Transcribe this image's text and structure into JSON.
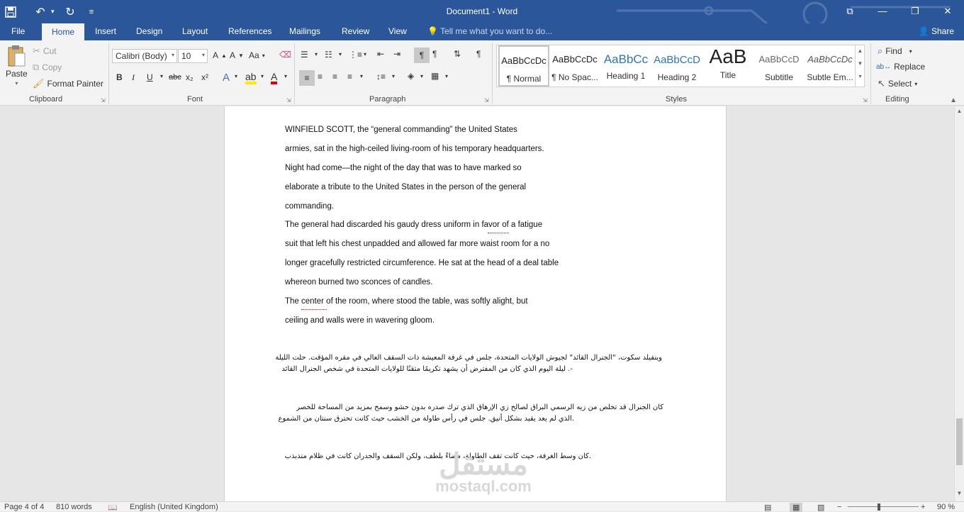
{
  "titlebar": {
    "doc_title": "Document1 - Word",
    "qat": [
      "save-icon",
      "undo-icon",
      "redo-icon",
      "customize-icon"
    ]
  },
  "tabs": {
    "file": "File",
    "home": "Home",
    "insert": "Insert",
    "design": "Design",
    "layout": "Layout",
    "references": "References",
    "mailings": "Mailings",
    "review": "Review",
    "view": "View",
    "tellme": "Tell me what you want to do...",
    "share": "Share"
  },
  "clipboard": {
    "paste": "Paste",
    "cut": "Cut",
    "copy": "Copy",
    "format_painter": "Format Painter",
    "label": "Clipboard"
  },
  "font": {
    "family": "Calibri (Body)",
    "size": "10",
    "change_case": "Aa",
    "label": "Font",
    "bold": "B",
    "italic": "I",
    "underline": "U",
    "strike": "abc",
    "sub": "x₂",
    "sup": "x²"
  },
  "paragraph": {
    "label": "Paragraph"
  },
  "styles": {
    "label": "Styles",
    "items": [
      {
        "preview": "AaBbCcDc",
        "name": "¶ Normal"
      },
      {
        "preview": "AaBbCcDc",
        "name": "¶ No Spac..."
      },
      {
        "preview": "AaBbCc",
        "name": "Heading 1"
      },
      {
        "preview": "AaBbCcD",
        "name": "Heading 2"
      },
      {
        "preview": "AaB",
        "name": "Title"
      },
      {
        "preview": "AaBbCcD",
        "name": "Subtitle"
      },
      {
        "preview": "AaBbCcDc",
        "name": "Subtle Em..."
      }
    ]
  },
  "editing": {
    "label": "Editing",
    "find": "Find",
    "replace": "Replace",
    "select": "Select"
  },
  "document": {
    "lines": [
      "WINFIELD SCOTT, the “general commanding” the United States",
      "armies, sat in the high-ceiled living-room of his temporary headquarters.",
      "Night had come—the night of the day that was to have marked so",
      "elaborate a tribute to the United States in the person of the general",
      "commanding.",
      "The general had discarded his gaudy dress uniform in favor of a fatigue",
      "suit that left his chest unpadded and allowed far more waist room for a no",
      "longer gracefully restricted circumference. He sat at the head of a deal table",
      "whereon burned two sconces of candles.",
      "The center of the room, where stood the table, was softly alight, but",
      "ceiling and walls were in wavering gloom."
    ],
    "arabic": [
      "وينفيلد سكوت، \"الجنرال القائد\" لجيوش الولايات المتحدة، جلس في غرفة المعيشة ذات السقف العالي في مقره المؤقت. حلت الليلة",
      "-. ليلة اليوم الذي كان من المفترض أن يشهد تكريمًا متقنًا للولايات المتحدة في شخص الجنرال القائد",
      "كان الجنرال قد تخلص من زيه الرسمي البراق لصالح زي الإرهاق الذي ترك صدره بدون حشو وسمح بمزيد من المساحة للخصر",
      ".الذي لم يعد يقيد بشكل أنيق. جلس في رأس طاولة من الخشب حيث كانت تحترق سنتان من الشموع",
      ".كان وسط الغرفة، حيث كانت تقف الطاولة، مضاءً بلطف، ولكن السقف والجدران كانت في ظلام متذبذب"
    ],
    "watermark_ar": "مستقل",
    "watermark_en": "mostaql.com"
  },
  "status": {
    "page": "Page 4 of 4",
    "words": "810 words",
    "language": "English (United Kingdom)",
    "zoom": "90 %"
  }
}
